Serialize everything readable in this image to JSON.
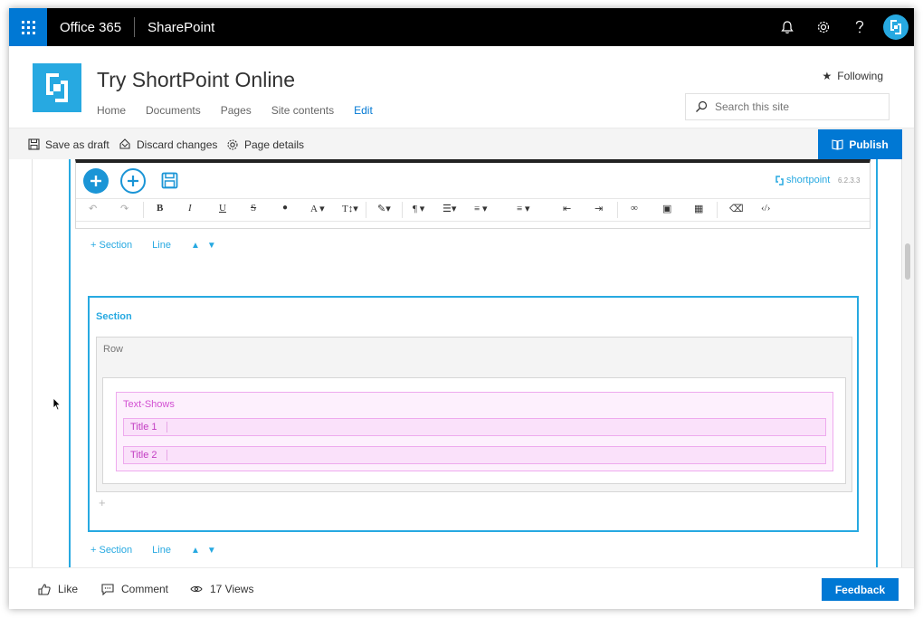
{
  "suite": {
    "app_name": "Office 365",
    "product": "SharePoint",
    "icons": [
      "waffle-icon",
      "bell-icon",
      "gear-icon",
      "help-icon",
      "avatar"
    ]
  },
  "site": {
    "title": "Try ShortPoint Online",
    "nav": [
      "Home",
      "Documents",
      "Pages",
      "Site contents",
      "Edit"
    ],
    "following_label": "Following",
    "search_placeholder": "Search this site"
  },
  "commands": {
    "save_draft": "Save as draft",
    "discard": "Discard changes",
    "page_details": "Page details",
    "publish": "Publish"
  },
  "shortpoint": {
    "brand": "shortpoint",
    "version": "6.2.3.3",
    "controls": {
      "add_section": "+ Section",
      "line": "Line"
    },
    "section_label": "Section",
    "row_label": "Row",
    "element_label": "Text-Shows",
    "items": [
      "Title 1",
      "Title 2"
    ]
  },
  "social": {
    "like": "Like",
    "comment": "Comment",
    "views": "17 Views",
    "feedback": "Feedback"
  },
  "colors": {
    "suite_bg": "#000000",
    "accent": "#0078d4",
    "shortpoint_blue": "#27a9e1",
    "element_pink": "#d24fd2"
  }
}
